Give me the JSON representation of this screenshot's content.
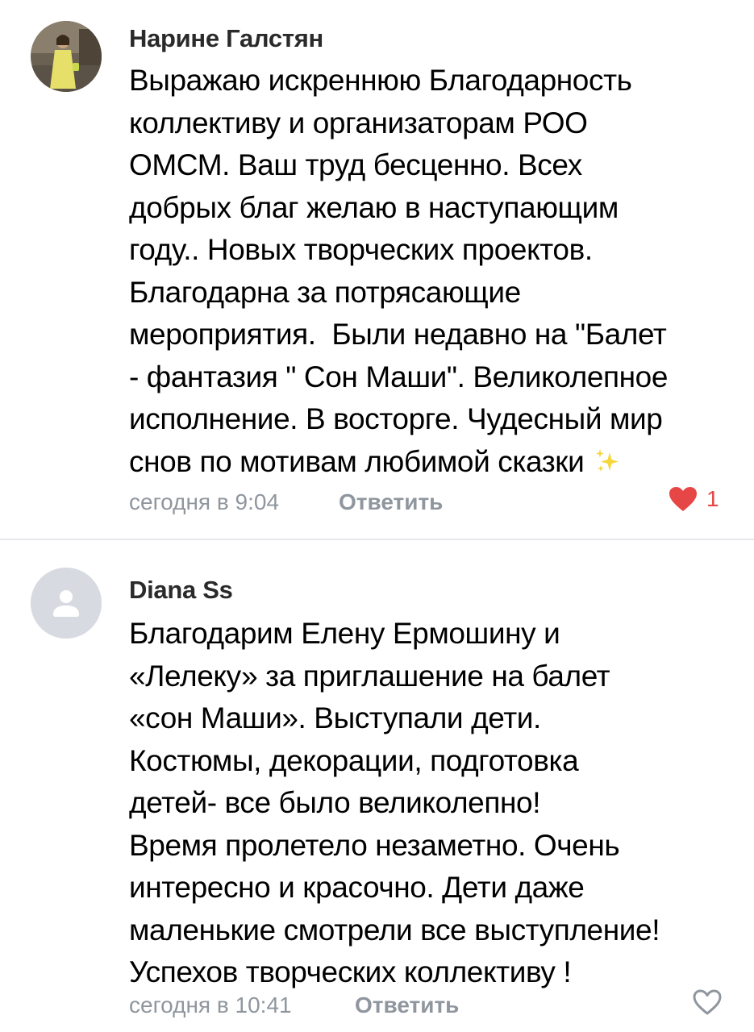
{
  "comments": [
    {
      "author": "Нарине Галстян",
      "text_lines": [
        "Выражаю искреннюю Благодарность",
        "коллективу и организаторам РОО",
        "ОМСМ. Ваш труд бесценно. Всех",
        "добрых благ желаю в наступающим",
        "году.. Новых творческих проектов.",
        "Благодарна за потрясающие",
        "мероприятия.  Были недавно на \"Балет",
        "- фантазия \" Сон Маши\". Великолепное",
        "исполнение. В восторге. Чудесный мир",
        "снов по мотивам любимой сказки"
      ],
      "emoji": "sparkles-icon",
      "timestamp": "сегодня в 9:04",
      "reply_label": "Ответить",
      "likes": "1",
      "liked": true
    },
    {
      "author": "Diana Ss",
      "text_lines": [
        "Благодарим Елену Ермошину и",
        "«Лелеку» за приглашение на балет",
        "«сон Маши». Выступали дети.",
        "Костюмы, декорации, подготовка",
        "детей- все было великолепно!",
        "Время пролетело незаметно. Очень",
        "интересно и красочно. Дети даже",
        "маленькие смотрели все выступление!",
        "Успехов творческих коллективу !"
      ],
      "timestamp": "сегодня в 10:41",
      "reply_label": "Ответить",
      "likes": "",
      "liked": false
    }
  ],
  "colors": {
    "meta_gray": "#8f969e",
    "like_red": "#e64646",
    "divider": "#e7e8ec",
    "avatar_placeholder": "#d7dbe1"
  }
}
